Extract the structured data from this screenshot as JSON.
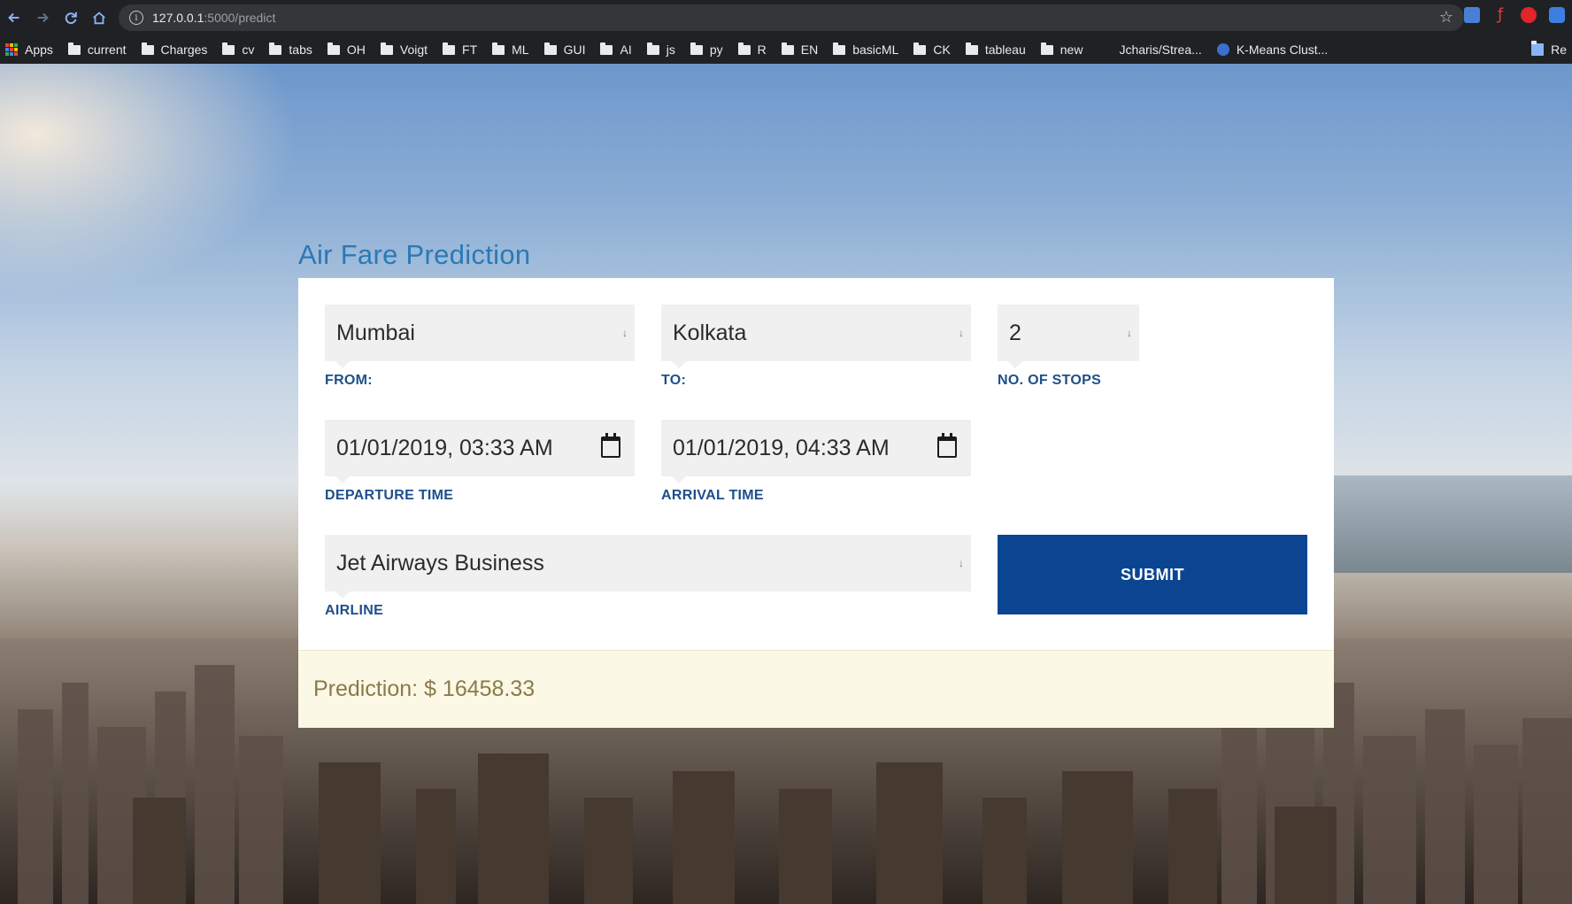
{
  "browser": {
    "url_host": "127.0.0.1",
    "url_path": ":5000/predict",
    "bookmarks": [
      "Apps",
      "current",
      "Charges",
      "cv",
      "tabs",
      "OH",
      "Voigt",
      "FT",
      "ML",
      "GUI",
      "AI",
      "js",
      "py",
      "R",
      "EN",
      "basicML",
      "CK",
      "tableau",
      "new"
    ],
    "bookmark_link_1": "Jcharis/Strea...",
    "bookmark_link_2": "K-Means Clust...",
    "bookmark_right": "Re"
  },
  "form": {
    "title": "Air Fare Prediction",
    "from": {
      "value": "Mumbai",
      "label": "FROM:"
    },
    "to": {
      "value": "Kolkata",
      "label": "TO:"
    },
    "stops": {
      "value": "2",
      "label": "NO. OF STOPS"
    },
    "departure": {
      "value": "01/01/2019, 03:33 AM",
      "label": "DEPARTURE TIME"
    },
    "arrival": {
      "value": "01/01/2019, 04:33 AM",
      "label": "ARRIVAL TIME"
    },
    "airline": {
      "value": "Jet Airways Business",
      "label": "AIRLINE"
    },
    "submit_label": "SUBMIT"
  },
  "result": {
    "prediction_text": "Prediction: $ 16458.33"
  },
  "colors": {
    "title": "#2a79b5",
    "label": "#1e4f8a",
    "submit_bg": "#0b4592",
    "prediction_bg": "#fbf8e5",
    "prediction_text": "#8a7a4c"
  }
}
